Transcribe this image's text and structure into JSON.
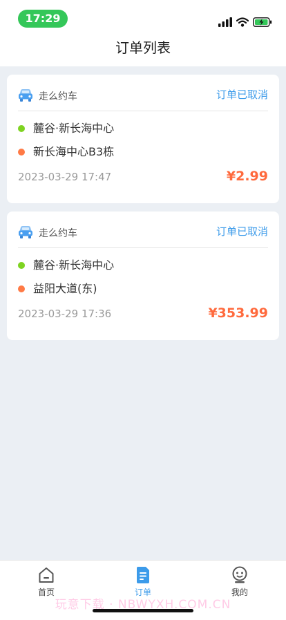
{
  "status_bar": {
    "time": "17:29",
    "icons": [
      "signal-icon",
      "wifi-icon",
      "battery-charging-icon"
    ]
  },
  "header": {
    "title": "订单列表"
  },
  "orders": [
    {
      "service": "走么约车",
      "status": "订单已取消",
      "from": "麓谷·新长海中心",
      "to": "新长海中心B3栋",
      "time": "2023-03-29 17:47",
      "price": "¥2.99"
    },
    {
      "service": "走么约车",
      "status": "订单已取消",
      "from": "麓谷·新长海中心",
      "to": "益阳大道(东)",
      "time": "2023-03-29 17:36",
      "price": "¥353.99"
    }
  ],
  "tabbar": {
    "items": [
      {
        "label": "首页",
        "icon": "home-icon"
      },
      {
        "label": "订单",
        "icon": "order-document-icon",
        "active": true
      },
      {
        "label": "我的",
        "icon": "profile-icon"
      }
    ]
  },
  "watermark": "玩意下载 · NBWYXH.COM.CN",
  "colors": {
    "accent_blue": "#3C9BEA",
    "price_orange": "#FF6A3D",
    "start_dot": "#7ED321",
    "end_dot": "#FF7A45",
    "time_pill": "#34C759",
    "background": "#EBEFF4"
  }
}
